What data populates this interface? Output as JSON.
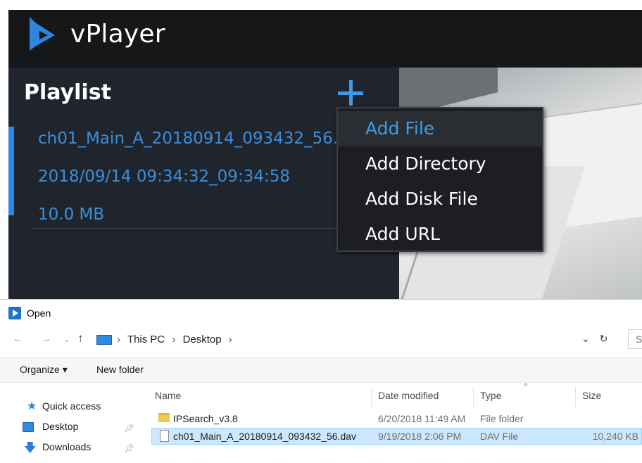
{
  "vplayer": {
    "app_title": "vPlayer",
    "playlist_title": "Playlist",
    "playlist_item": {
      "name": "ch01_Main_A_20180914_093432_56.",
      "time_range": "2018/09/14 09:34:32_09:34:58",
      "size": "10.0 MB"
    },
    "add_menu": [
      "Add File",
      "Add Directory",
      "Add Disk File",
      "Add URL"
    ],
    "colors": {
      "accent": "#3d9be9",
      "panel": "#20252d",
      "titlebar": "#161718"
    }
  },
  "dialog": {
    "title": "Open",
    "breadcrumb": [
      "This PC",
      "Desktop"
    ],
    "search_placeholder": "Se",
    "toolbar": {
      "organize": "Organize ▾",
      "new_folder": "New folder"
    },
    "nav_pane": [
      "Quick access",
      "Desktop",
      "Downloads"
    ],
    "columns": [
      "Name",
      "Date modified",
      "Type",
      "Size"
    ],
    "files": [
      {
        "name": "IPSearch_v3.8",
        "date": "6/20/2018 11:49 AM",
        "type": "File folder",
        "size": "",
        "icon": "folder-icon"
      },
      {
        "name": "ch01_Main_A_20180914_093432_56.dav",
        "date": "9/19/2018 2:06 PM",
        "type": "DAV File",
        "size": "10,240 KB",
        "icon": "file-icon"
      }
    ]
  }
}
